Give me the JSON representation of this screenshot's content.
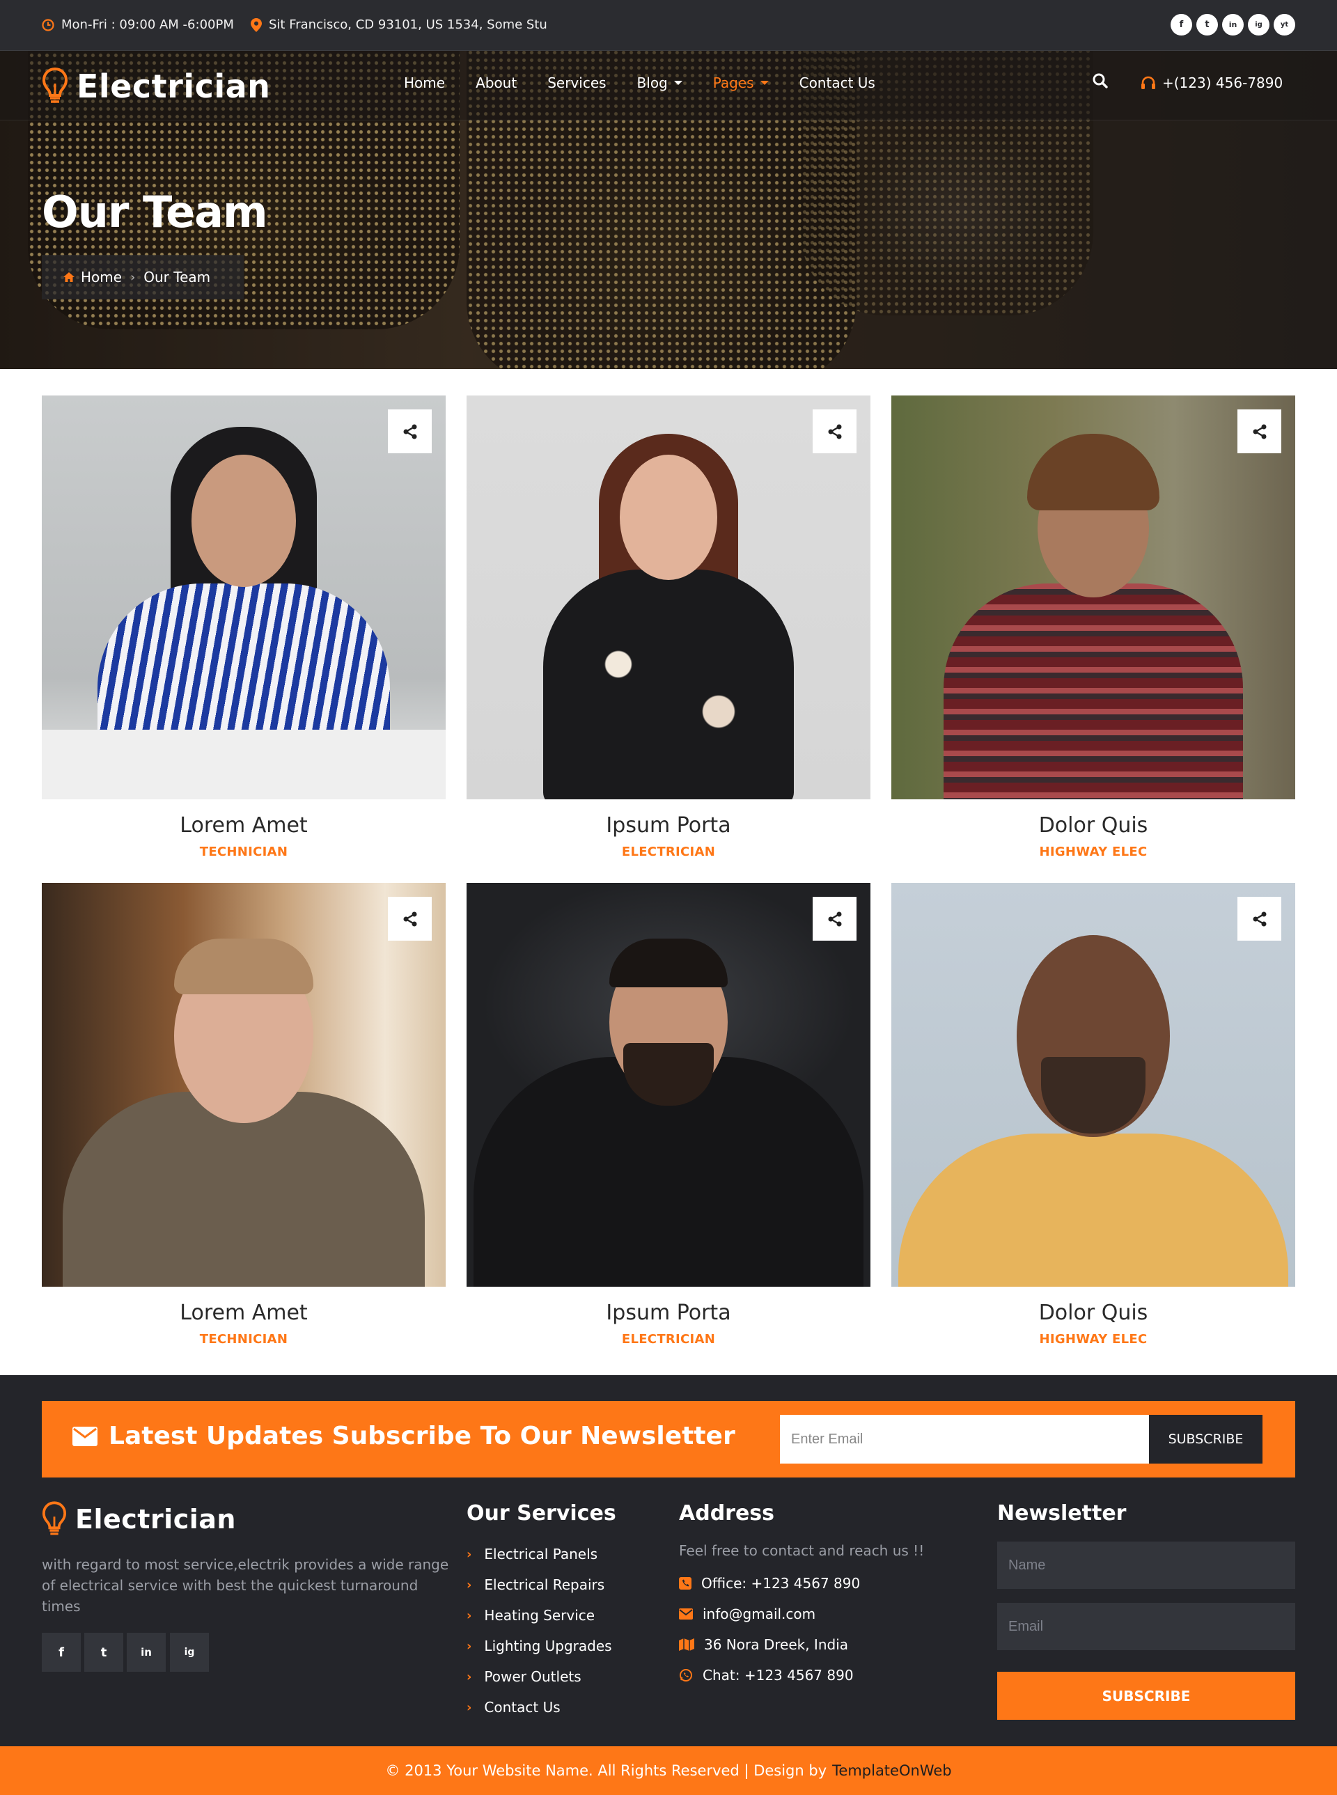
{
  "topbar": {
    "hours": "Mon-Fri : 09:00 AM -6:00PM",
    "address": "Sit Francisco, CD 93101, US 1534, Some Stu",
    "socials": [
      "f",
      "t",
      "in",
      "ig",
      "yt"
    ]
  },
  "brand": {
    "name": "Electrician",
    "accent": "#fe7717",
    "dark": "#24252a"
  },
  "nav": {
    "items": [
      {
        "label": "Home"
      },
      {
        "label": "About"
      },
      {
        "label": "Services"
      },
      {
        "label": "Blog"
      },
      {
        "label": "Pages"
      },
      {
        "label": "Contact Us"
      }
    ],
    "active": "Pages",
    "phone": "+(123) 456-7890"
  },
  "hero": {
    "title": "Our Team",
    "breadcrumb": {
      "home": "Home",
      "current": "Our Team"
    }
  },
  "team": [
    {
      "name": "Lorem Amet",
      "role": "TECHNICIAN"
    },
    {
      "name": "Ipsum Porta",
      "role": "ELECTRICIAN"
    },
    {
      "name": "Dolor Quis",
      "role": "HIGHWAY ELEC"
    },
    {
      "name": "Lorem Amet",
      "role": "TECHNICIAN"
    },
    {
      "name": "Ipsum Porta",
      "role": "ELECTRICIAN"
    },
    {
      "name": "Dolor Quis",
      "role": "HIGHWAY ELEC"
    }
  ],
  "newsletter_bar": {
    "title": "Latest Updates Subscribe To Our Newsletter",
    "email_placeholder": "Enter Email",
    "button": "SUBSCRIBE"
  },
  "footer": {
    "about": "with regard to most service,electrik provides a wide range of electrical service with best the quickest turnaround times",
    "services_title": "Our Services",
    "services": [
      "Electrical Panels",
      "Electrical Repairs",
      "Heating Service",
      "Lighting Upgrades",
      "Power Outlets",
      "Contact Us"
    ],
    "address_title": "Address",
    "address_intro": "Feel free to contact and reach us !!",
    "contacts": [
      {
        "icon": "phone-square-icon",
        "text": "Office: +123 4567 890"
      },
      {
        "icon": "envelope-icon",
        "text": "info@gmail.com"
      },
      {
        "icon": "map-icon",
        "text": "36 Nora Dreek, India"
      },
      {
        "icon": "whatsapp-icon",
        "text": "Chat: +123 4567 890"
      }
    ],
    "newsletter_title": "Newsletter",
    "name_placeholder": "Name",
    "email_placeholder": "Email",
    "subscribe": "SUBSCRIBE"
  },
  "copyright": {
    "text": "© 2013 Your Website Name. All Rights Reserved | Design by",
    "link": "TemplateOnWeb"
  }
}
